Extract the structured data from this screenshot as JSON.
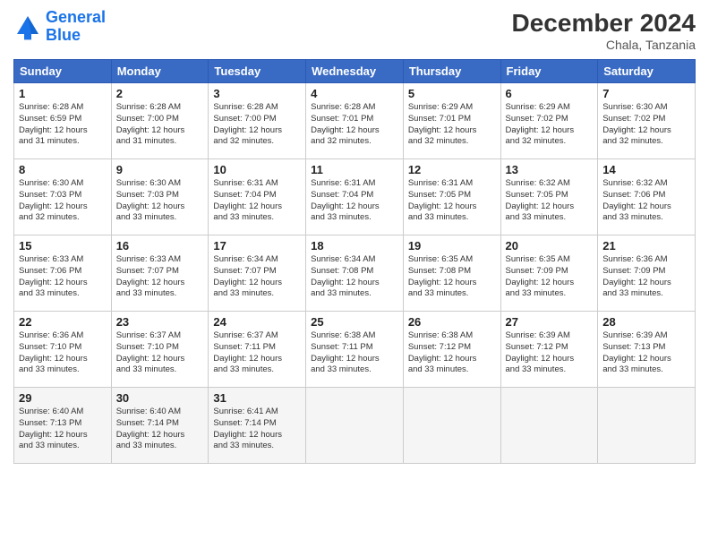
{
  "header": {
    "logo_general": "General",
    "logo_blue": "Blue",
    "month_year": "December 2024",
    "location": "Chala, Tanzania"
  },
  "weekdays": [
    "Sunday",
    "Monday",
    "Tuesday",
    "Wednesday",
    "Thursday",
    "Friday",
    "Saturday"
  ],
  "weeks": [
    [
      {
        "day": "1",
        "info": "Sunrise: 6:28 AM\nSunset: 6:59 PM\nDaylight: 12 hours\nand 31 minutes."
      },
      {
        "day": "2",
        "info": "Sunrise: 6:28 AM\nSunset: 7:00 PM\nDaylight: 12 hours\nand 31 minutes."
      },
      {
        "day": "3",
        "info": "Sunrise: 6:28 AM\nSunset: 7:00 PM\nDaylight: 12 hours\nand 32 minutes."
      },
      {
        "day": "4",
        "info": "Sunrise: 6:28 AM\nSunset: 7:01 PM\nDaylight: 12 hours\nand 32 minutes."
      },
      {
        "day": "5",
        "info": "Sunrise: 6:29 AM\nSunset: 7:01 PM\nDaylight: 12 hours\nand 32 minutes."
      },
      {
        "day": "6",
        "info": "Sunrise: 6:29 AM\nSunset: 7:02 PM\nDaylight: 12 hours\nand 32 minutes."
      },
      {
        "day": "7",
        "info": "Sunrise: 6:30 AM\nSunset: 7:02 PM\nDaylight: 12 hours\nand 32 minutes."
      }
    ],
    [
      {
        "day": "8",
        "info": "Sunrise: 6:30 AM\nSunset: 7:03 PM\nDaylight: 12 hours\nand 32 minutes."
      },
      {
        "day": "9",
        "info": "Sunrise: 6:30 AM\nSunset: 7:03 PM\nDaylight: 12 hours\nand 33 minutes."
      },
      {
        "day": "10",
        "info": "Sunrise: 6:31 AM\nSunset: 7:04 PM\nDaylight: 12 hours\nand 33 minutes."
      },
      {
        "day": "11",
        "info": "Sunrise: 6:31 AM\nSunset: 7:04 PM\nDaylight: 12 hours\nand 33 minutes."
      },
      {
        "day": "12",
        "info": "Sunrise: 6:31 AM\nSunset: 7:05 PM\nDaylight: 12 hours\nand 33 minutes."
      },
      {
        "day": "13",
        "info": "Sunrise: 6:32 AM\nSunset: 7:05 PM\nDaylight: 12 hours\nand 33 minutes."
      },
      {
        "day": "14",
        "info": "Sunrise: 6:32 AM\nSunset: 7:06 PM\nDaylight: 12 hours\nand 33 minutes."
      }
    ],
    [
      {
        "day": "15",
        "info": "Sunrise: 6:33 AM\nSunset: 7:06 PM\nDaylight: 12 hours\nand 33 minutes."
      },
      {
        "day": "16",
        "info": "Sunrise: 6:33 AM\nSunset: 7:07 PM\nDaylight: 12 hours\nand 33 minutes."
      },
      {
        "day": "17",
        "info": "Sunrise: 6:34 AM\nSunset: 7:07 PM\nDaylight: 12 hours\nand 33 minutes."
      },
      {
        "day": "18",
        "info": "Sunrise: 6:34 AM\nSunset: 7:08 PM\nDaylight: 12 hours\nand 33 minutes."
      },
      {
        "day": "19",
        "info": "Sunrise: 6:35 AM\nSunset: 7:08 PM\nDaylight: 12 hours\nand 33 minutes."
      },
      {
        "day": "20",
        "info": "Sunrise: 6:35 AM\nSunset: 7:09 PM\nDaylight: 12 hours\nand 33 minutes."
      },
      {
        "day": "21",
        "info": "Sunrise: 6:36 AM\nSunset: 7:09 PM\nDaylight: 12 hours\nand 33 minutes."
      }
    ],
    [
      {
        "day": "22",
        "info": "Sunrise: 6:36 AM\nSunset: 7:10 PM\nDaylight: 12 hours\nand 33 minutes."
      },
      {
        "day": "23",
        "info": "Sunrise: 6:37 AM\nSunset: 7:10 PM\nDaylight: 12 hours\nand 33 minutes."
      },
      {
        "day": "24",
        "info": "Sunrise: 6:37 AM\nSunset: 7:11 PM\nDaylight: 12 hours\nand 33 minutes."
      },
      {
        "day": "25",
        "info": "Sunrise: 6:38 AM\nSunset: 7:11 PM\nDaylight: 12 hours\nand 33 minutes."
      },
      {
        "day": "26",
        "info": "Sunrise: 6:38 AM\nSunset: 7:12 PM\nDaylight: 12 hours\nand 33 minutes."
      },
      {
        "day": "27",
        "info": "Sunrise: 6:39 AM\nSunset: 7:12 PM\nDaylight: 12 hours\nand 33 minutes."
      },
      {
        "day": "28",
        "info": "Sunrise: 6:39 AM\nSunset: 7:13 PM\nDaylight: 12 hours\nand 33 minutes."
      }
    ],
    [
      {
        "day": "29",
        "info": "Sunrise: 6:40 AM\nSunset: 7:13 PM\nDaylight: 12 hours\nand 33 minutes."
      },
      {
        "day": "30",
        "info": "Sunrise: 6:40 AM\nSunset: 7:14 PM\nDaylight: 12 hours\nand 33 minutes."
      },
      {
        "day": "31",
        "info": "Sunrise: 6:41 AM\nSunset: 7:14 PM\nDaylight: 12 hours\nand 33 minutes."
      },
      {
        "day": "",
        "info": ""
      },
      {
        "day": "",
        "info": ""
      },
      {
        "day": "",
        "info": ""
      },
      {
        "day": "",
        "info": ""
      }
    ]
  ]
}
